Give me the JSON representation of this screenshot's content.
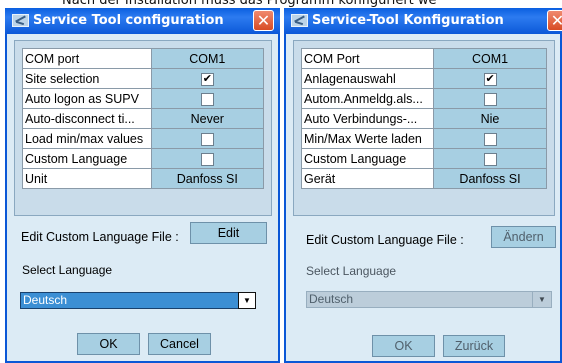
{
  "page_caption": "Nach der Installation muss das Programm konfiguriert we",
  "dialogs": [
    {
      "title": "Service Tool configuration",
      "rows": [
        {
          "label": "COM port",
          "value": "COM1"
        },
        {
          "label": "Site selection",
          "checkbox": true
        },
        {
          "label": "Auto logon as SUPV",
          "checkbox": false
        },
        {
          "label": "Auto-disconnect ti...",
          "value": "Never"
        },
        {
          "label": "Load min/max values",
          "checkbox": false
        },
        {
          "label": "Custom Language",
          "checkbox": false
        },
        {
          "label": "Unit",
          "value": "Danfoss SI"
        }
      ],
      "edit_label": "Edit Custom Language File :",
      "edit_button": "Edit",
      "select_label": "Select Language",
      "language_value": "Deutsch",
      "ok_button": "OK",
      "cancel_button": "Cancel"
    },
    {
      "title": "Service-Tool Konfiguration",
      "rows": [
        {
          "label": "COM Port",
          "value": "COM1"
        },
        {
          "label": "Anlagenauswahl",
          "checkbox": true
        },
        {
          "label": "Autom.Anmeldg.als...",
          "checkbox": false
        },
        {
          "label": "Auto Verbindungs-...",
          "value": "Nie"
        },
        {
          "label": "Min/Max Werte laden",
          "checkbox": false
        },
        {
          "label": "Custom Language",
          "checkbox": false
        },
        {
          "label": "Gerät",
          "value": "Danfoss SI"
        }
      ],
      "edit_label": "Edit Custom Language File :",
      "edit_button": "Ändern",
      "select_label": "Select Language",
      "language_value": "Deutsch",
      "ok_button": "OK",
      "cancel_button": "Zurück"
    }
  ],
  "colors": {
    "titlebar": "#0a57d6",
    "dialog_background": "#dcebf5",
    "value_cell": "#a7cfe2",
    "close_button": "#d84b25"
  },
  "icons": {
    "title": "service-tool-icon",
    "close": "close-icon",
    "dropdown": "chevron-down-icon"
  }
}
